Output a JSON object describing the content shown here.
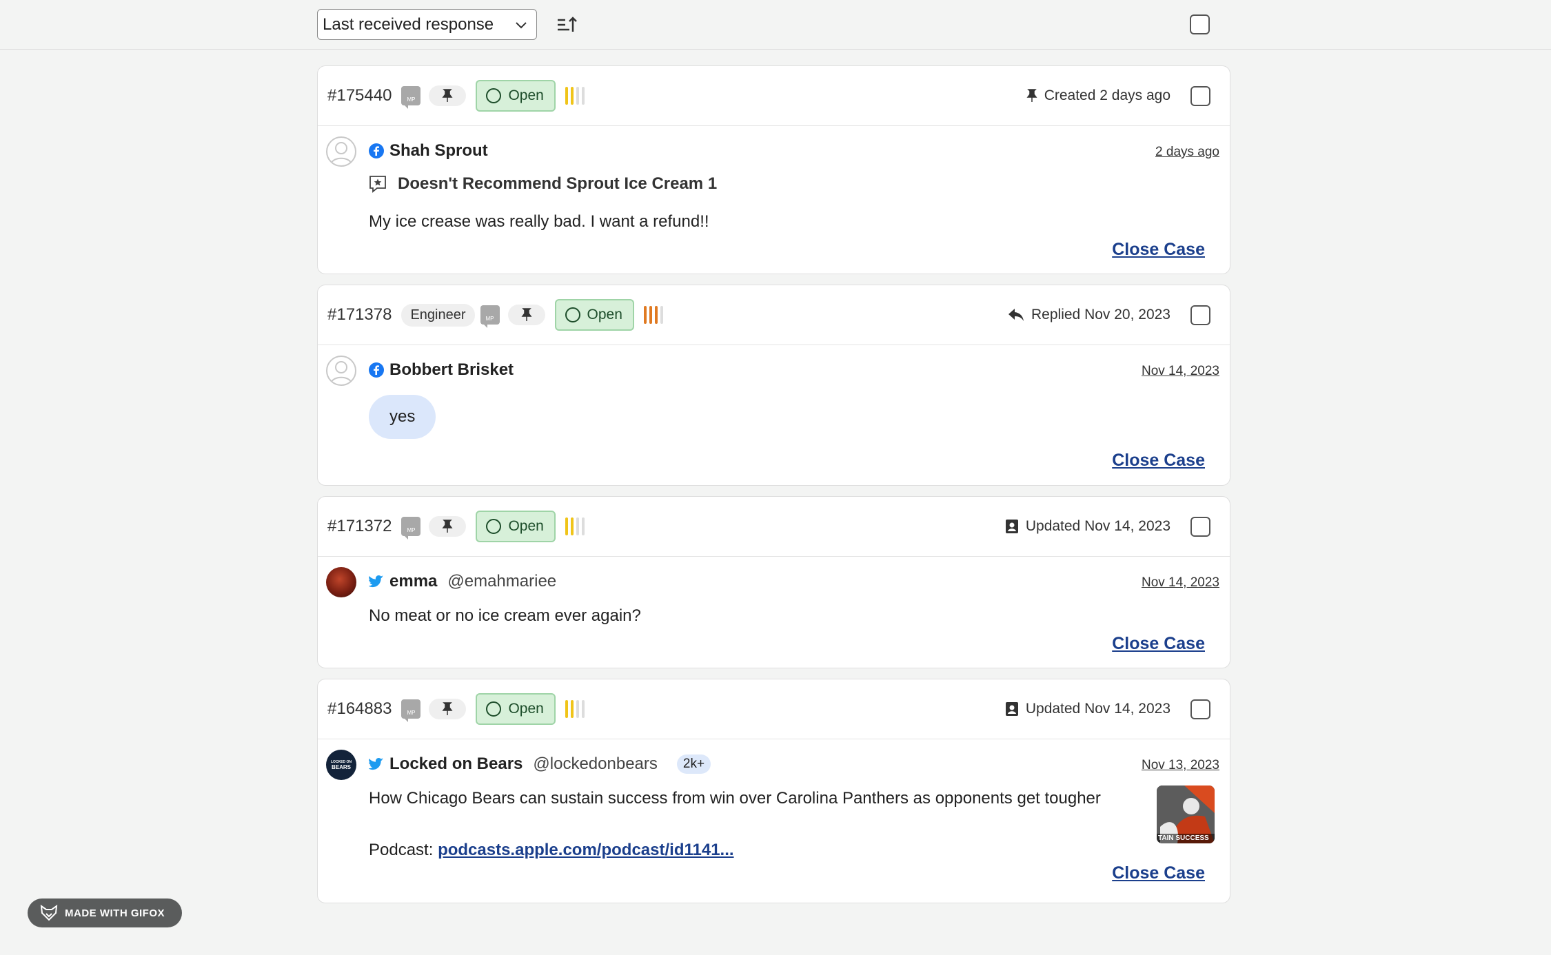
{
  "toolbar": {
    "sort_label": "Last received response",
    "sort_icon": "sort-ascending-icon",
    "select_all_checked": false
  },
  "colors": {
    "status_bg": "#d7f0d9",
    "status_border": "#9fd4a7",
    "link": "#1b3f8c",
    "facebook": "#1877f2",
    "twitter": "#1d9bf0",
    "priority_yellow": "#f0c419",
    "priority_orange": "#e07a22"
  },
  "cases": [
    {
      "id": "#175440",
      "tag": "",
      "mp_label": "MP",
      "status": "Open",
      "priority_level": 2,
      "priority_color": "#f0c419",
      "meta_icon": "pin-icon",
      "meta_text": "Created 2 days ago",
      "network": "facebook-icon",
      "author": "Shah Sprout",
      "handle": "",
      "date": "2 days ago",
      "review_title": "Doesn't Recommend Sprout Ice Cream 1",
      "message": "My ice crease was really bad. I want a refund!!",
      "close_label": "Close Case"
    },
    {
      "id": "#171378",
      "tag": "Engineer",
      "mp_label": "MP",
      "status": "Open",
      "priority_level": 3,
      "priority_color": "#e07a22",
      "meta_icon": "reply-icon",
      "meta_text": "Replied Nov 20, 2023",
      "network": "facebook-icon",
      "author": "Bobbert Brisket",
      "handle": "",
      "date": "Nov 14, 2023",
      "message": "yes",
      "close_label": "Close Case"
    },
    {
      "id": "#171372",
      "tag": "",
      "mp_label": "MP",
      "status": "Open",
      "priority_level": 2,
      "priority_color": "#f0c419",
      "meta_icon": "contact-card-icon",
      "meta_text": "Updated Nov 14, 2023",
      "network": "twitter-icon",
      "author": "emma",
      "handle": "@emahmariee",
      "date": "Nov 14, 2023",
      "message": "No meat or no ice cream ever again?",
      "close_label": "Close Case"
    },
    {
      "id": "#164883",
      "tag": "",
      "mp_label": "MP",
      "status": "Open",
      "priority_level": 2,
      "priority_color": "#f0c419",
      "meta_icon": "contact-card-icon",
      "meta_text": "Updated Nov 14, 2023",
      "network": "twitter-icon",
      "author": "Locked on Bears",
      "handle": "@lockedonbears",
      "followers": "2k+",
      "date": "Nov 13, 2023",
      "message": "How Chicago Bears can sustain success from win over Carolina Panthers as opponents get tougher",
      "podcast_prefix": "Podcast: ",
      "podcast_link": "podcasts.apple.com/podcast/id1141...",
      "thumb_caption": "TAIN SUCCESS",
      "avatar_text_top": "LOCKED ON",
      "avatar_text_bottom": "BEARS",
      "close_label": "Close Case"
    }
  ],
  "watermark": "MADE WITH GIFOX"
}
